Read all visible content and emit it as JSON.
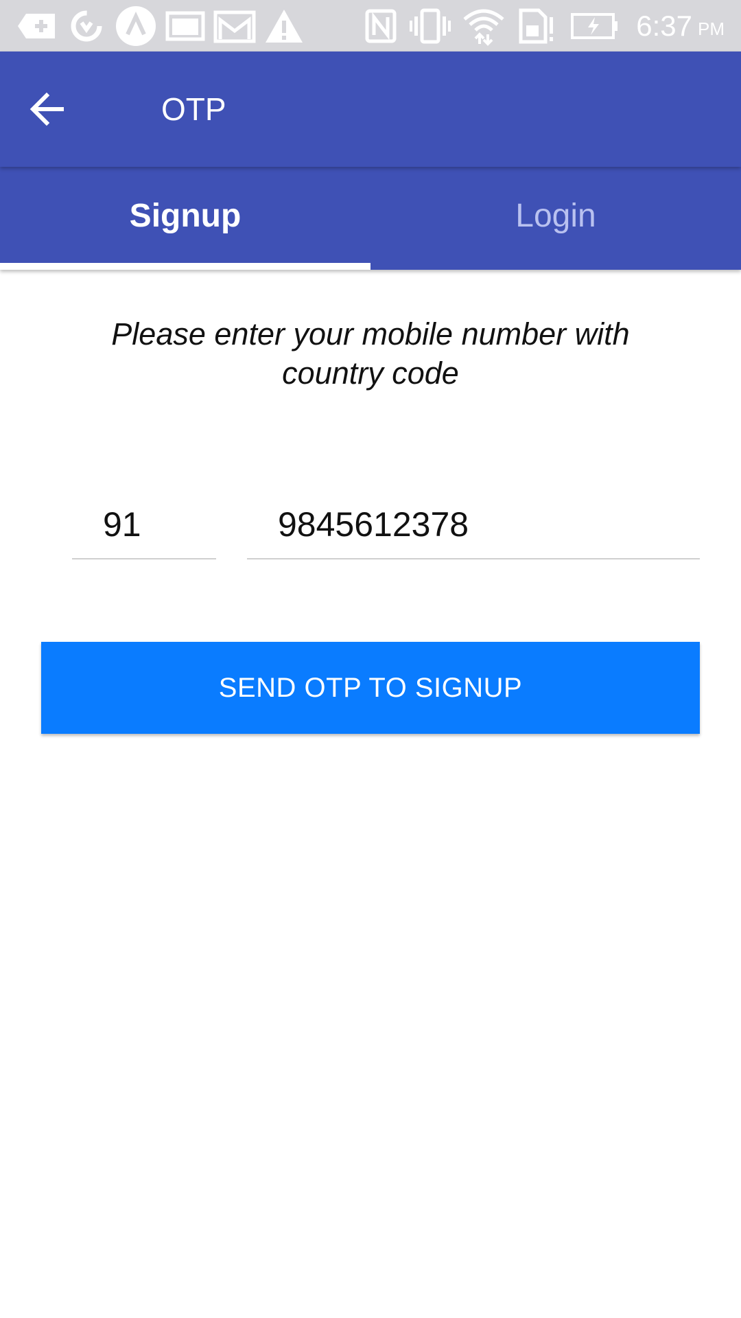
{
  "status_bar": {
    "time": "6:37",
    "ampm": "PM",
    "left_icons": [
      "add-icon",
      "sync-icon",
      "nav-app-icon",
      "image-icon",
      "mail-icon",
      "warning-icon"
    ],
    "right_icons": [
      "nfc-icon",
      "vibrate-icon",
      "wifi-icon",
      "sim-alert-icon",
      "battery-charging-icon"
    ]
  },
  "app_bar": {
    "title": "OTP",
    "back_icon": "arrow-back-icon"
  },
  "tabs": [
    {
      "label": "Signup",
      "active": true
    },
    {
      "label": "Login",
      "active": false
    }
  ],
  "form": {
    "instruction": "Please enter your mobile number with country code",
    "country_code": "91",
    "phone_number": "9845612378",
    "submit_label": "SEND OTP TO SIGNUP"
  },
  "colors": {
    "primary": "#3f51b5",
    "button": "#0a7cff",
    "status_bar": "#d7d7db",
    "inactive_tab_text": "#b9c1f0"
  }
}
